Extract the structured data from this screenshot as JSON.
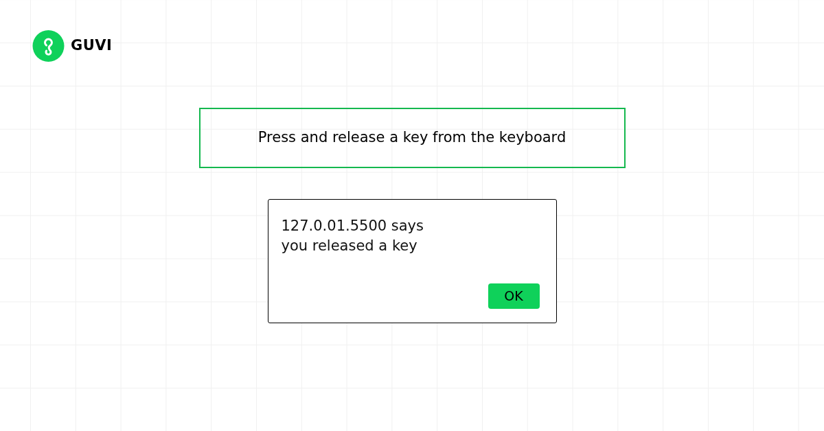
{
  "logo": {
    "text": "GUVI"
  },
  "prompt": {
    "text": "Press and release a key from the keyboard"
  },
  "alert": {
    "origin": "127.0.01.5500 says",
    "message": "you released a key",
    "button": "OK"
  }
}
